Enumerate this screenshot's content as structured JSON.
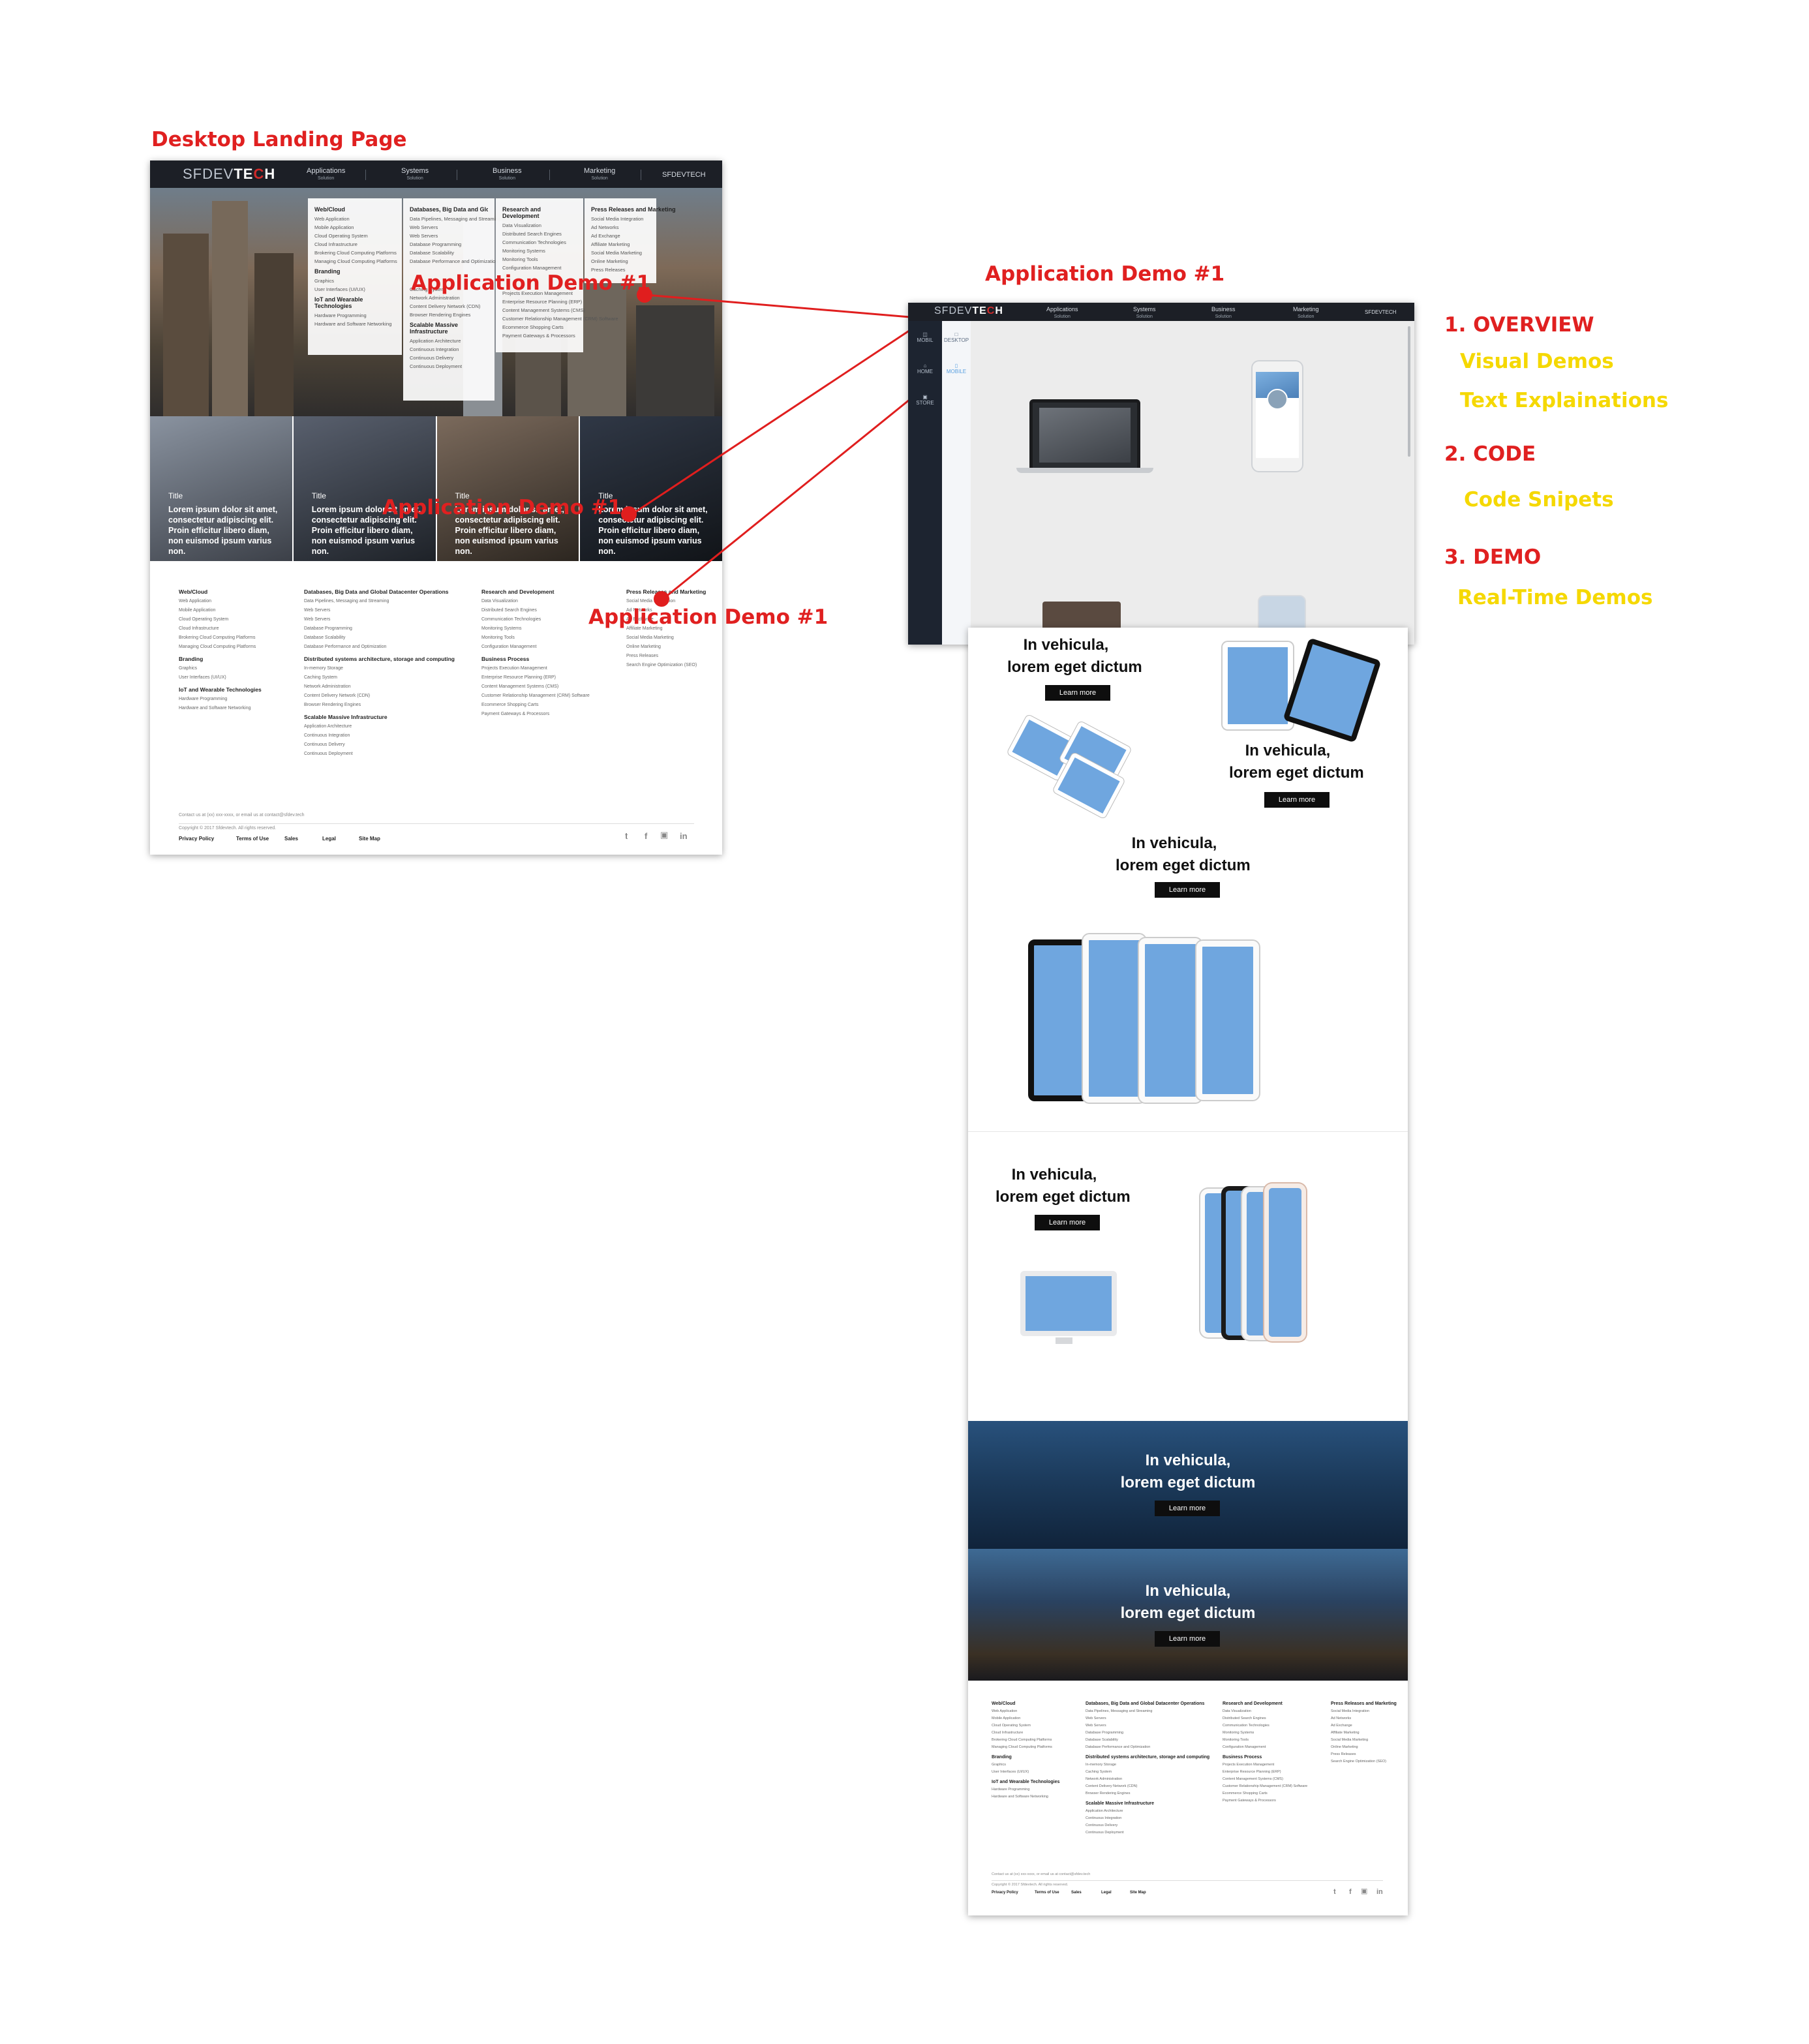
{
  "labels": {
    "desktop_landing": "Desktop Landing Page",
    "app_demo_top": "Application Demo #1",
    "app_demo_overlay_1": "Application Demo #1",
    "app_demo_overlay_2": "Application Demo #1",
    "app_demo_overlay_3": "Application Demo #1"
  },
  "notes": {
    "overview": "1. OVERVIEW",
    "visual_demos": "Visual Demos",
    "text_explanations": "Text Explainations",
    "code": "2. CODE",
    "code_snippets": "Code Snipets",
    "demo": "3. DEMO",
    "realtime_demos": "Real-Time Demos"
  },
  "landing": {
    "logo_left": "SFDEV",
    "logo_right_a": "TE",
    "logo_right_c": "C",
    "logo_right_h": "H",
    "nav": [
      {
        "label": "Applications",
        "sub": "Solution"
      },
      {
        "label": "Systems",
        "sub": "Solution"
      },
      {
        "label": "Business",
        "sub": "Solution"
      },
      {
        "label": "Marketing",
        "sub": "Solution"
      }
    ],
    "nav_right": "SFDEVTECH",
    "menu": [
      {
        "heading": "Web/Cloud",
        "items": [
          "Web Application",
          "Mobile Application",
          "Cloud Operating System",
          "Cloud Infrastructure",
          "Brokering Cloud Computing Platforms",
          "Managing Cloud Computing Platforms"
        ],
        "heading2": "Branding",
        "items2": [
          "Graphics",
          "User Interfaces (UI/UX)"
        ],
        "heading3": "IoT and Wearable Technologies",
        "items3": [
          "Hardware Programming",
          "Hardware and Software Networking"
        ]
      },
      {
        "heading": "Databases, Big Data and Global Datacenter Operations",
        "items": [
          "Data Pipelines, Messaging and Streaming",
          "Web Servers",
          "Web Servers",
          "Database Programming",
          "Database Scalability",
          "Database Performance and Optimization"
        ],
        "heading2": "",
        "items2": [
          "Caching System",
          "Network Administration",
          "Content Delivery Network (CDN)",
          "Browser Rendering Engines"
        ],
        "heading3": "Scalable Massive Infrastructure",
        "items3": [
          "Application Architecture",
          "Continuous Integration",
          "Continuous Delivery",
          "Continuous Deployment"
        ]
      },
      {
        "heading": "Research and Development",
        "items": [
          "Data Visualization",
          "Distributed Search Engines",
          "Communication Technologies",
          "Monitoring Systems",
          "Monitoring Tools",
          "Configuration Management"
        ],
        "heading2": "",
        "items2": [
          "Projects Execution Management",
          "Enterprise Resource Planning (ERP)",
          "Content Management Systems (CMS)",
          "Customer Relationship Management (CRM) Software",
          "Ecommerce Shopping Carts",
          "Payment Gateways & Processors"
        ],
        "heading3": "",
        "items3": []
      },
      {
        "heading": "Press Releases and Marketing",
        "items": [
          "Social Media Integration",
          "Ad Networks",
          "Ad Exchange",
          "Affiliate Marketing",
          "Social Media Marketing",
          "Online Marketing",
          "Press Releases"
        ],
        "heading2": "",
        "items2": [],
        "heading3": "",
        "items3": []
      }
    ],
    "tiles": [
      {
        "title": "Title",
        "text": "Lorem ipsum dolor sit amet, consectetur adipiscing elit. Proin efficitur libero diam, non euismod ipsum varius non."
      },
      {
        "title": "Title",
        "text": "Lorem ipsum dolor sit amet, consectetur adipiscing elit. Proin efficitur libero diam, non euismod ipsum varius non."
      },
      {
        "title": "Title",
        "text": "Lorem ipsum dolor sit amet, consectetur adipiscing elit. Proin efficitur libero diam, non euismod ipsum varius non."
      },
      {
        "title": "Title",
        "text": "Lorem ipsum dolor sit amet, consectetur adipiscing elit. Proin efficitur libero diam, non euismod ipsum varius non."
      }
    ],
    "footer": [
      {
        "groups": [
          {
            "h": "Web/Cloud",
            "items": [
              "Web Application",
              "Mobile Application",
              "Cloud Operating System",
              "Cloud Infrastructure",
              "Brokering Cloud Computing Platforms",
              "Managing Cloud Computing Platforms"
            ]
          },
          {
            "h": "Branding",
            "items": [
              "Graphics",
              "User Interfaces (UI/UX)"
            ]
          },
          {
            "h": "IoT and Wearable Technologies",
            "items": [
              "Hardware Programming",
              "Hardware and Software Networking"
            ]
          }
        ]
      },
      {
        "groups": [
          {
            "h": "Databases, Big Data and Global Datacenter Operations",
            "items": [
              "Data Pipelines, Messaging and Streaming",
              "Web Servers",
              "Web Servers",
              "Database Programming",
              "Database Scalability",
              "Database Performance and Optimization"
            ]
          },
          {
            "h": "Distributed systems architecture, storage and computing",
            "items": [
              "In-memory Storage",
              "Caching System",
              "Network Administration",
              "Content Delivery Network (CDN)",
              "Browser Rendering Engines"
            ]
          },
          {
            "h": "Scalable Massive Infrastructure",
            "items": [
              "Application Architecture",
              "Continuous Integration",
              "Continuous Delivery",
              "Continuous Deployment"
            ]
          }
        ]
      },
      {
        "groups": [
          {
            "h": "Research and Development",
            "items": [
              "Data Visualization",
              "Distributed Search Engines",
              "Communication Technologies",
              "Monitoring Systems",
              "Monitoring Tools",
              "Configuration Management"
            ]
          },
          {
            "h": "Business Process",
            "items": [
              "Projects Execution Management",
              "Enterprise Resource Planning (ERP)",
              "Content Management Systems (CMS)",
              "Customer Relationship Management (CRM) Software",
              "Ecommerce Shopping Carts",
              "Payment Gateways & Processors"
            ]
          }
        ]
      },
      {
        "groups": [
          {
            "h": "Press Releases and Marketing",
            "items": [
              "Social Media Integration",
              "Ad Networks",
              "Ad Exchange",
              "Affiliate Marketing",
              "Social Media Marketing",
              "Online Marketing",
              "Press Releases",
              "Search Engine Optimization (SEO)"
            ]
          }
        ]
      }
    ],
    "contact": "Contact us at (xx) xxx-xxxx, or email us at contact@sfdev.tech",
    "copyright": "Copyright © 2017 Sfdevtech. All rights reserved.",
    "footer_links": [
      "Privacy Policy",
      "Terms of Use",
      "Sales",
      "Legal",
      "Site Map"
    ],
    "social": [
      "twitter-icon",
      "facebook-icon",
      "instagram-icon",
      "linkedin-icon"
    ]
  },
  "app_demo": {
    "nav_right": "SFDEVTECH",
    "side": [
      "MOBIL",
      "HOME",
      "STORE"
    ],
    "side2": [
      "DESKTOP",
      "MOBILE"
    ]
  },
  "long_page": {
    "promo_title_1": "In vehicula,",
    "promo_title_2": "lorem eget dictum",
    "learn_more": "Learn more"
  }
}
